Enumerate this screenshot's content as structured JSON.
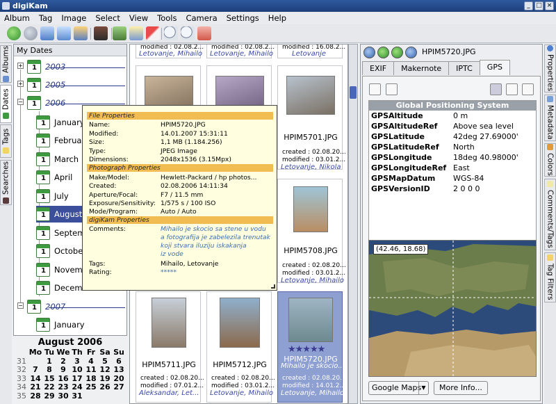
{
  "window": {
    "title": "digiKam"
  },
  "menu": [
    "Album",
    "Tag",
    "Image",
    "Select",
    "View",
    "Tools",
    "Camera",
    "Settings",
    "Help"
  ],
  "left_tabs": [
    {
      "label": "Albums",
      "icon": "album-icon"
    },
    {
      "label": "Dates",
      "icon": "calendar-icon"
    },
    {
      "label": "Tags",
      "icon": "tag-icon"
    },
    {
      "label": "Searches",
      "icon": "binoculars-icon"
    }
  ],
  "right_tabs": [
    {
      "label": "Properties",
      "icon": "info-icon"
    },
    {
      "label": "Metadata",
      "icon": "metadata-icon"
    },
    {
      "label": "Colors",
      "icon": "colors-icon"
    },
    {
      "label": "Comments/Tags",
      "icon": "comment-icon"
    },
    {
      "label": "Tag Filters",
      "icon": "tag-filter-icon"
    }
  ],
  "dates": {
    "header": "My Dates",
    "years": [
      "2003",
      "2005",
      "2006",
      "2007"
    ],
    "months_2006": [
      "January",
      "February",
      "March",
      "April",
      "July",
      "August",
      "September",
      "October",
      "November",
      "December"
    ],
    "months_2007": [
      "January"
    ]
  },
  "calendar": {
    "title": "August 2006",
    "weekdays": [
      "Mo",
      "Tu",
      "We",
      "Th",
      "Fr",
      "Sa",
      "Su"
    ],
    "weeks": [
      {
        "wk": "31",
        "days": [
          "",
          "1",
          "2",
          "3",
          "4",
          "5",
          "6"
        ]
      },
      {
        "wk": "32",
        "days": [
          "7",
          "8",
          "9",
          "10",
          "11",
          "12",
          "13"
        ]
      },
      {
        "wk": "33",
        "days": [
          "14",
          "15",
          "16",
          "17",
          "18",
          "19",
          "20"
        ]
      },
      {
        "wk": "34",
        "days": [
          "21",
          "22",
          "23",
          "24",
          "25",
          "26",
          "27"
        ]
      },
      {
        "wk": "35",
        "days": [
          "28",
          "29",
          "30",
          "31",
          "",
          "",
          ""
        ]
      }
    ]
  },
  "thumbnails": [
    {
      "l2": "modified : 02.08.2...",
      "l3": "Letovanje, Mihailo"
    },
    {
      "l2": "modified : 02.08.2...",
      "l3": "Letovanje, Mihailo"
    },
    {
      "l2": "modified : 16.08.2...",
      "l3": "Letovanje"
    },
    {
      "fn": "HPIM5701.JPG",
      "l1": "created : 02.08.20...",
      "l2": "modified : 03.01.2...",
      "l3": "Letovanje, Nikola"
    },
    {
      "fn": "HPIM5708.JPG",
      "l1": "created : 02.08.20...",
      "l2": "modified : 03.01.2...",
      "l3": "Letovanje, Mihailo"
    },
    {
      "fn": "HPIM5711.JPG",
      "l1": "created : 02.08.20...",
      "l2": "modified : 07.01.2...",
      "l3": "Aleksandar, Let..."
    },
    {
      "fn": "HPIM5712.JPG",
      "l1": "created : 02.08.20...",
      "l2": "modified : 03.01.2...",
      "l3": "Letovanje, Mihailo"
    },
    {
      "fn": "HPIM5720.JPG",
      "l1": "created : 02.08.20...",
      "l2": "modified : 14.01.2...",
      "l3": "Letovanje, Mihailo",
      "comment": "Mihailo je skocio...",
      "rating": 5
    }
  ],
  "tooltip": {
    "file_header": "File Properties",
    "file": [
      [
        "Name:",
        "HPIM5720.JPG"
      ],
      [
        "Modified:",
        "14.01.2007 15:31:11"
      ],
      [
        "Size:",
        "1,1 MB (1.184.256)"
      ],
      [
        "Type:",
        "JPEG Image"
      ],
      [
        "Dimensions:",
        "2048x1536 (3.15Mpx)"
      ]
    ],
    "photo_header": "Photograph Properties",
    "photo": [
      [
        "Make/Model:",
        "Hewlett-Packard / hp photos..."
      ],
      [
        "Created:",
        "02.08.2006 14:11:34"
      ],
      [
        "Aperture/Focal:",
        "F7 / 11.5 mm"
      ],
      [
        "Exposure/Sensitivity:",
        "1/575 s / 100 ISO"
      ],
      [
        "Mode/Program:",
        "Auto / Auto"
      ]
    ],
    "digikam_header": "digiKam Properties",
    "comments_label": "Comments:",
    "comments": [
      "Mihailo je skocio sa stene u vodu",
      "a fotografija je zabelezila trenutak",
      "koji stvara iluziju iskakanja",
      "iz vode"
    ],
    "tags_label": "Tags:",
    "tags": "Mihailo, Letovanje",
    "rating_label": "Rating:",
    "rating": "*****"
  },
  "right": {
    "filename": "HPIM5720.JPG",
    "tabs": [
      "EXIF",
      "Makernote",
      "IPTC",
      "GPS"
    ],
    "active_tab": "GPS",
    "table_title": "Global Positioning System",
    "rows": [
      [
        "GPSAltitude",
        "0 m"
      ],
      [
        "GPSAltitudeRef",
        "Above sea level"
      ],
      [
        "GPSLatitude",
        "42deg 27.69000'"
      ],
      [
        "GPSLatitudeRef",
        "North"
      ],
      [
        "GPSLongitude",
        "18deg 40.98000'"
      ],
      [
        "GPSLongitudeRef",
        "East"
      ],
      [
        "GPSMapDatum",
        "WGS-84"
      ],
      [
        "GPSVersionID",
        "2 0 0 0"
      ]
    ],
    "map_coord": "(42.46, 18.68)",
    "map_service": "Google Maps",
    "more_info": "More Info..."
  },
  "colors": {
    "title": "#1f4480",
    "accent": "#f1bd52",
    "link": "#3b4aa8",
    "selection": "#8e9fd2"
  }
}
